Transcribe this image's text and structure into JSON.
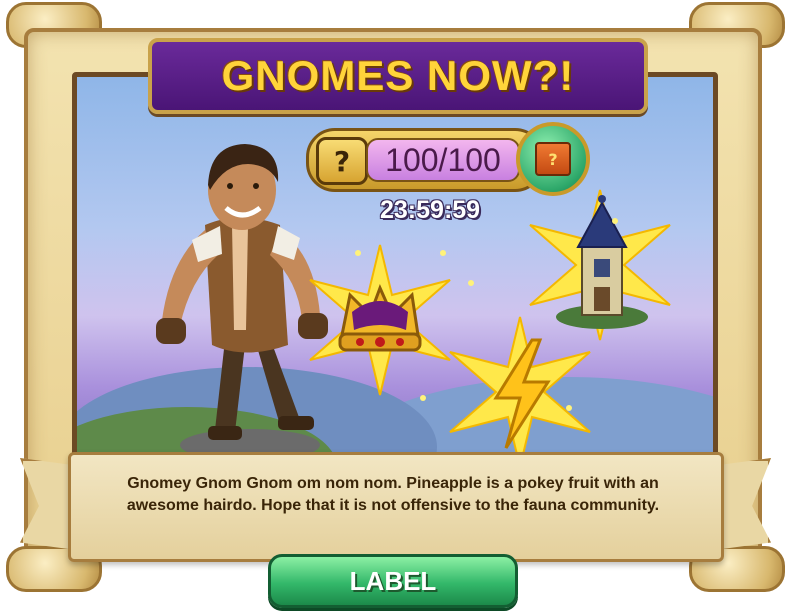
{
  "popup": {
    "title": "GNOMES NOW?!",
    "progress": {
      "question_mark": "?",
      "count_text": "100/100",
      "current": 100,
      "max": 100
    },
    "gift_box_mark": "?",
    "timer": "23:59:59",
    "rewards": [
      {
        "name": "crown-icon"
      },
      {
        "name": "tower-icon"
      },
      {
        "name": "lightning-bolt-icon"
      }
    ],
    "description": "Gnomey Gnom Gnom om nom nom. Pineapple is a pokey fruit with an awesome hairdo. Hope that it is not offensive to the fauna community.",
    "button_label": "LABEL"
  },
  "colors": {
    "title_text": "#ffd43a",
    "title_banner": "#5a1e86",
    "button_green": "#33b86a",
    "parchment": "#f3e3b0"
  }
}
